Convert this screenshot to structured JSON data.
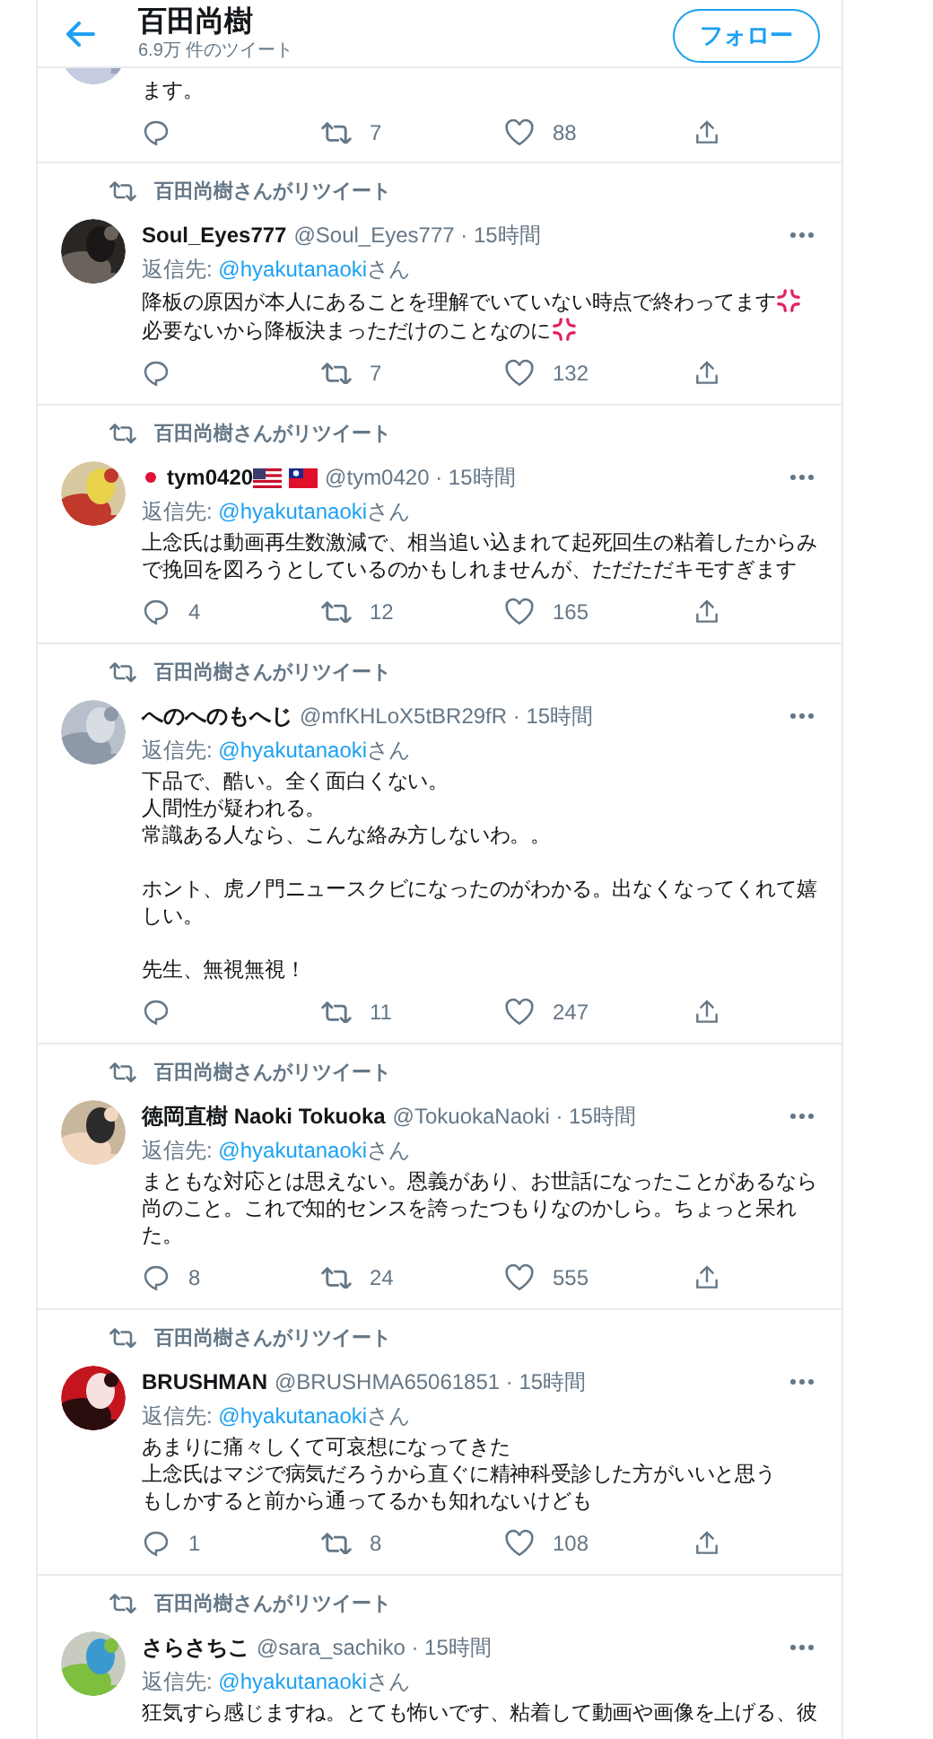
{
  "header": {
    "title": "百田尚樹",
    "subtitle": "6.9万 件のツイート",
    "follow": "フォロー"
  },
  "tweets": [
    {
      "body": [
        {
          "kind": "line",
          "parts": [
            {
              "kind": "text",
              "text": "ます。"
            }
          ]
        }
      ],
      "retweets": "7",
      "likes": "88"
    },
    {
      "retweet_label": "百田尚樹さんがリツイート",
      "name": [
        {
          "kind": "text",
          "text": "Soul_Eyes777"
        }
      ],
      "meta": "@Soul_Eyes777 · 15時間",
      "reply_prefix": "返信先: ",
      "reply_handle": "@hyakutanaoki",
      "reply_suffix": "さん",
      "body": [
        {
          "kind": "line",
          "parts": [
            {
              "kind": "text",
              "text": "降板の原因が本人にあることを理解でいていない時点で終わってます"
            },
            {
              "kind": "anger-emoji"
            },
            {
              "kind": "text",
              "text": "必要ないから降板決まっただけのことなのに"
            },
            {
              "kind": "anger-emoji"
            }
          ]
        }
      ],
      "retweets": "7",
      "likes": "132"
    },
    {
      "retweet_label": "百田尚樹さんがリツイート",
      "name": [
        {
          "kind": "japan-flag"
        },
        {
          "kind": "text",
          "text": "tym0420"
        },
        {
          "kind": "us-flag"
        },
        {
          "kind": "taiwan-flag"
        }
      ],
      "meta": "@tym0420 · 15時間",
      "reply_prefix": "返信先: ",
      "reply_handle": "@hyakutanaoki",
      "reply_suffix": "さん",
      "body": [
        {
          "kind": "line",
          "parts": [
            {
              "kind": "text",
              "text": "上念氏は動画再生数激減で、相当追い込まれて起死回生の粘着したからみで挽回を図ろうとしているのかもしれませんが、ただただキモすぎます"
            }
          ]
        }
      ],
      "replies": "4",
      "retweets": "12",
      "likes": "165"
    },
    {
      "retweet_label": "百田尚樹さんがリツイート",
      "name": [
        {
          "kind": "text",
          "text": "へのへのもへじ"
        }
      ],
      "meta": "@mfKHLoX5tBR29fR · 15時間",
      "reply_prefix": "返信先: ",
      "reply_handle": "@hyakutanaoki",
      "reply_suffix": "さん",
      "body": [
        {
          "kind": "line",
          "parts": [
            {
              "kind": "text",
              "text": "下品で、酷い。全く面白くない。"
            }
          ]
        },
        {
          "kind": "line",
          "parts": [
            {
              "kind": "text",
              "text": "人間性が疑われる。"
            }
          ]
        },
        {
          "kind": "line",
          "parts": [
            {
              "kind": "text",
              "text": "常識ある人なら、こんな絡み方しないわ。。"
            }
          ]
        },
        {
          "kind": "gap"
        },
        {
          "kind": "line",
          "parts": [
            {
              "kind": "text",
              "text": "ホント、虎ノ門ニュースクビになったのがわかる。出なくなってくれて嬉しい。"
            }
          ]
        },
        {
          "kind": "gap"
        },
        {
          "kind": "line",
          "parts": [
            {
              "kind": "text",
              "text": "先生、無視無視！"
            }
          ]
        }
      ],
      "retweets": "11",
      "likes": "247"
    },
    {
      "retweet_label": "百田尚樹さんがリツイート",
      "name": [
        {
          "kind": "text",
          "text": "徳岡直樹 Naoki Tokuoka"
        }
      ],
      "meta": "@TokuokaNaoki · 15時間",
      "reply_prefix": "返信先: ",
      "reply_handle": "@hyakutanaoki",
      "reply_suffix": "さん",
      "body": [
        {
          "kind": "line",
          "parts": [
            {
              "kind": "text",
              "text": "まともな対応とは思えない。恩義があり、お世話になったことがあるなら尚のこと。これで知的センスを誇ったつもりなのかしら。ちょっと呆れた。"
            }
          ]
        }
      ],
      "replies": "8",
      "retweets": "24",
      "likes": "555"
    },
    {
      "retweet_label": "百田尚樹さんがリツイート",
      "name": [
        {
          "kind": "text",
          "text": "BRUSHMAN"
        }
      ],
      "meta": "@BRUSHMA65061851 · 15時間",
      "reply_prefix": "返信先: ",
      "reply_handle": "@hyakutanaoki",
      "reply_suffix": "さん",
      "body": [
        {
          "kind": "line",
          "parts": [
            {
              "kind": "text",
              "text": "あまりに痛々しくて可哀想になってきた"
            }
          ]
        },
        {
          "kind": "line",
          "parts": [
            {
              "kind": "text",
              "text": "上念氏はマジで病気だろうから直ぐに精神科受診した方がいいと思う"
            }
          ]
        },
        {
          "kind": "line",
          "parts": [
            {
              "kind": "text",
              "text": "もしかすると前から通ってるかも知れないけども"
            }
          ]
        }
      ],
      "replies": "1",
      "retweets": "8",
      "likes": "108"
    },
    {
      "retweet_label": "百田尚樹さんがリツイート",
      "name": [
        {
          "kind": "text",
          "text": "さらさちこ"
        }
      ],
      "meta": "@sara_sachiko · 15時間",
      "reply_prefix": "返信先: ",
      "reply_handle": "@hyakutanaoki",
      "reply_suffix": "さん",
      "body": [
        {
          "kind": "line",
          "parts": [
            {
              "kind": "text",
              "text": "狂気すら感じますね。とても怖いです、粘着して動画や画像を上げる、彼"
            }
          ]
        }
      ]
    }
  ]
}
